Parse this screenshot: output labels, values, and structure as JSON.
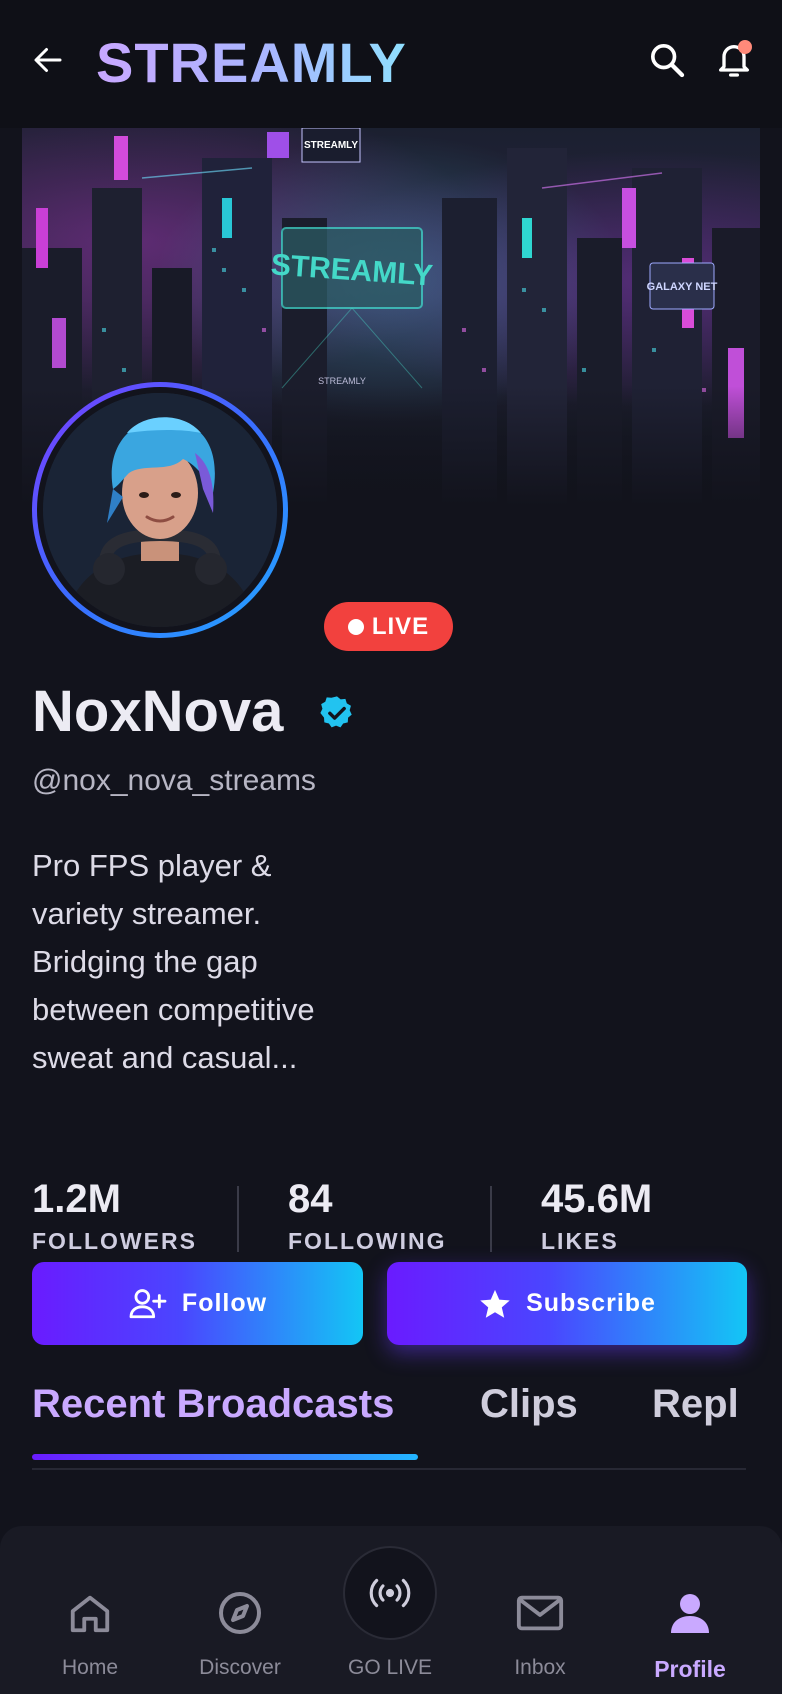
{
  "app": {
    "brand": "STREAMLY"
  },
  "header": {
    "back_icon": "arrow-left-icon",
    "search_icon": "search-icon",
    "notifications_icon": "bell-icon",
    "notification_dot_color": "#ff8a7a"
  },
  "banner": {
    "signs": [
      "STREAMLY",
      "STREAMLY",
      "GALAXY NET",
      "STREAMLY"
    ]
  },
  "profile": {
    "display_name": "NoxNova",
    "verified": true,
    "handle": "@nox_nova_streams",
    "live_label": "LIVE",
    "bio": "Pro FPS player & variety streamer. Bridging the gap between competitive sweat and casual...",
    "stats": [
      {
        "value": "1.2M",
        "label": "FOLLOWERS"
      },
      {
        "value": "84",
        "label": "FOLLOWING"
      },
      {
        "value": "45.6M",
        "label": "LIKES"
      }
    ]
  },
  "actions": {
    "follow_label": "Follow",
    "subscribe_label": "Subscribe"
  },
  "tabs": [
    {
      "label": "Recent Broadcasts",
      "active": true
    },
    {
      "label": "Clips",
      "active": false
    },
    {
      "label": "Repl",
      "active": false
    }
  ],
  "bottom_nav": [
    {
      "label": "Home",
      "icon": "home-icon",
      "active": false
    },
    {
      "label": "Discover",
      "icon": "compass-icon",
      "active": false
    },
    {
      "label": "GO LIVE",
      "icon": "broadcast-icon",
      "active": false
    },
    {
      "label": "Inbox",
      "icon": "mail-icon",
      "active": false
    },
    {
      "label": "Profile",
      "icon": "user-icon",
      "active": true
    }
  ],
  "colors": {
    "background": "#12131c",
    "accent_purple": "#c9a9ff",
    "live_red": "#f2413e",
    "verified_cyan": "#22c3f0",
    "gradient_start": "#6a1bff",
    "gradient_end": "#13c6f5"
  }
}
